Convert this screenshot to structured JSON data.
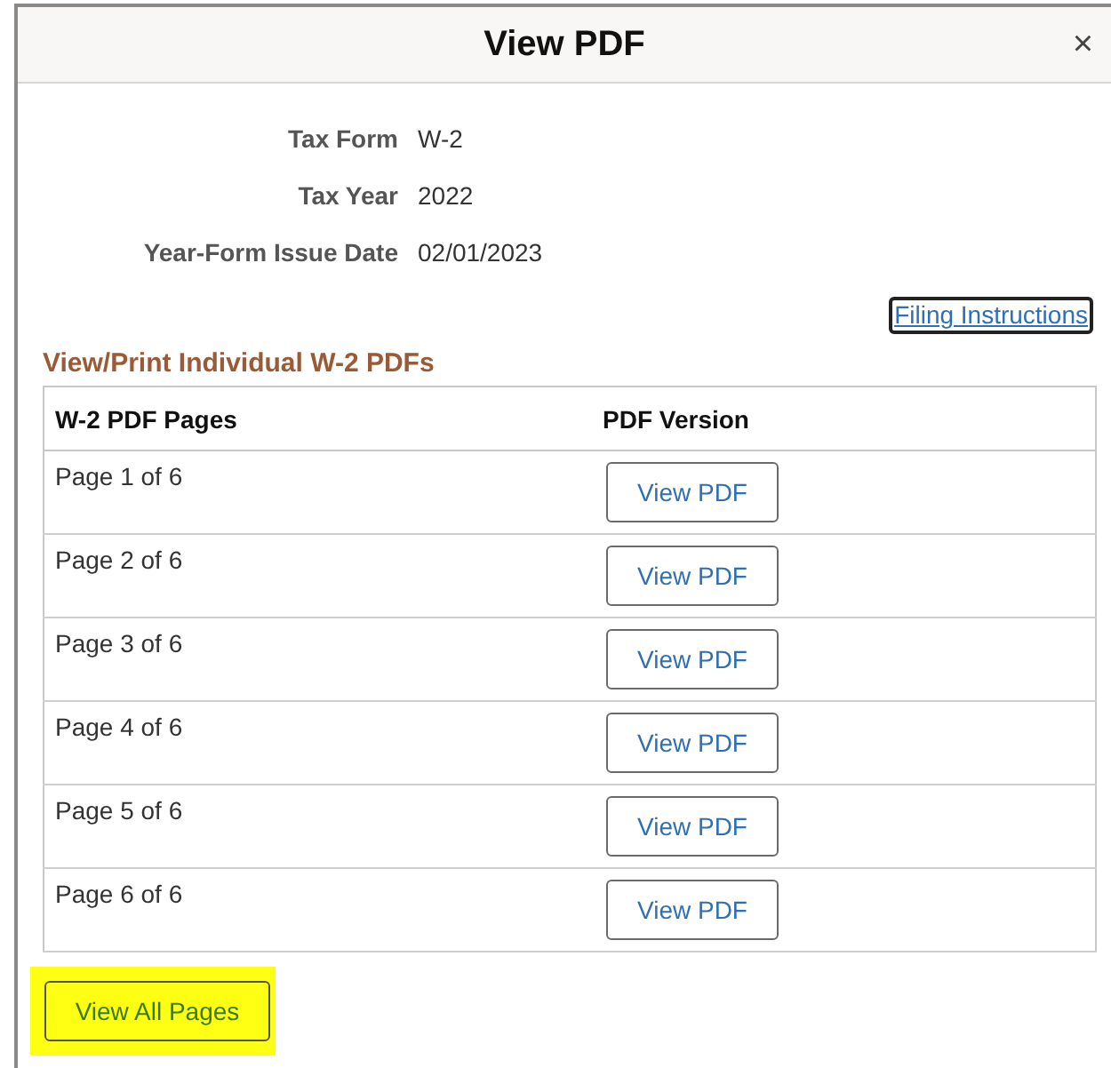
{
  "dialog": {
    "title": "View PDF",
    "close": "×"
  },
  "fields": [
    {
      "label": "Tax Form",
      "value": "W-2"
    },
    {
      "label": "Tax Year",
      "value": "2022"
    },
    {
      "label": "Year-Form Issue Date",
      "value": "02/01/2023"
    }
  ],
  "filing_link": "Filing Instructions",
  "section_title": "View/Print Individual W-2 PDFs",
  "table": {
    "columns": [
      "W-2 PDF Pages",
      "PDF Version"
    ],
    "rows": [
      {
        "page": "Page 1 of 6",
        "button": "View PDF"
      },
      {
        "page": "Page 2 of 6",
        "button": "View PDF"
      },
      {
        "page": "Page 3 of 6",
        "button": "View PDF"
      },
      {
        "page": "Page 4 of 6",
        "button": "View PDF"
      },
      {
        "page": "Page 5 of 6",
        "button": "View PDF"
      },
      {
        "page": "Page 6 of 6",
        "button": "View PDF"
      }
    ]
  },
  "view_all": {
    "label": "View All Pages",
    "highlighted": true
  }
}
